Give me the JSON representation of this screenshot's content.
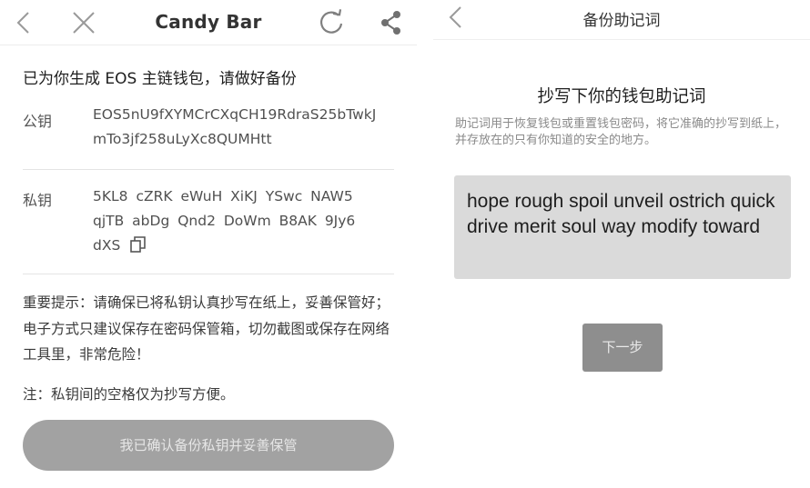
{
  "left": {
    "nav": {
      "title": "Candy Bar",
      "icons": [
        "back-chevron-icon",
        "close-icon",
        "refresh-icon",
        "share-icon"
      ]
    },
    "headline": "已为你生成 EOS 主链钱包，请做好备份",
    "public_key": {
      "label": "公钥",
      "lines": [
        "EOS5nU9fXYMCrCXqCH19RdraS25bTwkJ",
        "mTo3jf258uLyXc8QUMHtt"
      ]
    },
    "private_key": {
      "label": "私钥",
      "lines": [
        "5KL8 cZRK eWuH XiKJ YSwc NAW5",
        "qjTB abDg Qnd2 DoWm B8AK 9Jy6",
        "dXS"
      ]
    },
    "warning": "重要提示：请确保已将私钥认真抄写在纸上，妥善保管好；电子方式只建议保存在密码保管箱，切勿截图或保存在网络工具里，非常危险！",
    "note": "注：私钥间的空格仅为抄写方便。",
    "confirm_button": "我已确认备份私钥并妥善保管"
  },
  "right": {
    "nav": {
      "title": "备份助记词",
      "icons": [
        "back-chevron-icon"
      ]
    },
    "heading": "抄写下你的钱包助记词",
    "description": "助记词用于恢复钱包或重置钱包密码，将它准确的抄写到纸上，并存放在的只有你知道的安全的地方。",
    "mnemonic": "hope rough spoil unveil ostrich quick drive merit soul way modify toward",
    "next_button": "下一步"
  }
}
